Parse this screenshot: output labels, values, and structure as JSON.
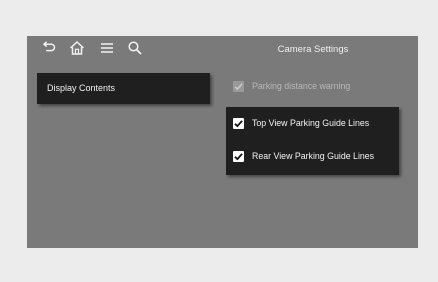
{
  "screen": {
    "title": "Camera Settings"
  },
  "toolbar": {
    "icons": [
      "back-icon",
      "home-icon",
      "menu-icon",
      "search-icon"
    ]
  },
  "sidebar": {
    "items": [
      {
        "label": "Display Contents",
        "selected": true
      }
    ]
  },
  "settings": [
    {
      "label": "Parking distance warning",
      "checked": true,
      "enabled": false
    },
    {
      "label": "Top View Parking Guide Lines",
      "checked": true,
      "enabled": true
    },
    {
      "label": "Rear View Parking Guide Lines",
      "checked": true,
      "enabled": true
    }
  ],
  "colors": {
    "page_background": "#ececec",
    "screen_background": "#7a7a7a",
    "panel_background": "#1f1f1f",
    "text_light": "#f3f3f3",
    "text_disabled": "#b8b8b8"
  }
}
